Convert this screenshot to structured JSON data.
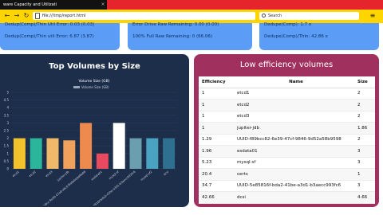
{
  "browser": {
    "tab_title": "ware Capacity and Utilizati",
    "tab_close": "×",
    "url": "file:///tmp/report.html",
    "search_placeholder": "Search",
    "menu_glyph": "≡"
  },
  "summary_cards": [
    {
      "line1": "Dedup(Comp)/Thin Util Error: 0.03 (0.03)",
      "line2": "Dedup(Comp)/Thin util Error: 6.87 (3.87)"
    },
    {
      "line1": "Error Drive Raw Remaining: 0.00 (0.00)",
      "line2": "100% Full Raw Remaining: 0 (66.06)"
    },
    {
      "line1": "Dedupe(Comp): 1.7 x",
      "line2": "Dedupe(Comp)/Thin: 42.86 x"
    }
  ],
  "left_panel": {
    "title": "Top Volumes by Size"
  },
  "chart_data": {
    "type": "bar",
    "title": "Volume Size (GB)",
    "legend": "Volume Size (GB)",
    "categories": [
      "etcd1",
      "etcd2",
      "etcd3",
      "jupiter-jdb",
      "UUID-3e6b8cc-9a36-47a8-a6c0-Ba8a0e8d9b98",
      "esdata01",
      "mysql-sf",
      "UUID-5e85816f-bda2-41be-a3d1-b3aecc993fc6",
      "mysql-sf2",
      "dcsi"
    ],
    "values": [
      2,
      2,
      2,
      1.86,
      3,
      1,
      3,
      2,
      2,
      2
    ],
    "colors": [
      "#f2c22d",
      "#2bb59a",
      "#efb86a",
      "#f0a15c",
      "#ef8a4e",
      "#e84a5f",
      "#ffffff",
      "#6b9eaf",
      "#4aa3c0",
      "#2f6f8f"
    ],
    "ylim": [
      0,
      5
    ],
    "yticks": [
      "0",
      "0.5",
      "1",
      "1.5",
      "2",
      "2.5",
      "3",
      "3.5",
      "4",
      "4.5",
      "5"
    ]
  },
  "right_panel": {
    "title": "Low efficiency volumes",
    "columns": [
      "Efficiency",
      "Name",
      "Size"
    ],
    "rows": [
      [
        "1",
        "etcd1",
        "2"
      ],
      [
        "1",
        "etcd2",
        "2"
      ],
      [
        "1",
        "etcd3",
        "2"
      ],
      [
        "1",
        "jupiter-jdb",
        "1.86"
      ],
      [
        "1.29",
        "UUID-f89bcc82-6e39-47cf-9846-9d52a58b9598",
        "2"
      ],
      [
        "1.96",
        "esdata01",
        "3"
      ],
      [
        "5.23",
        "mysql-sf",
        "3"
      ],
      [
        "20.4",
        "certs",
        "1"
      ],
      [
        "34.7",
        "UUID-5e85816f-bda2-41be-a3d1-b3aecc993fc6",
        "3"
      ],
      [
        "42.66",
        "dcsi",
        "4.66"
      ]
    ]
  }
}
